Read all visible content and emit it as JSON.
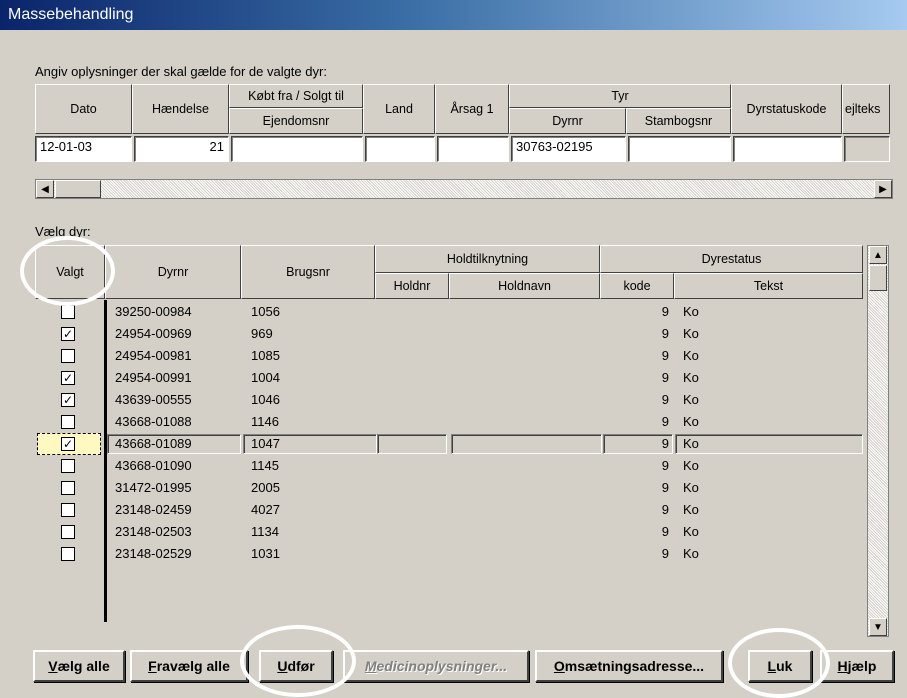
{
  "window": {
    "title": "Massebehandling"
  },
  "top_section": {
    "label": "Angiv oplysninger der skal gælde for de valgte dyr:",
    "headers": {
      "dato": "Dato",
      "haendelse": "Hændelse",
      "kobt_solgt": "Købt fra / Solgt til",
      "ejendomsnr": "Ejendomsnr",
      "land": "Land",
      "aarsag": "Årsag 1",
      "tyr": "Tyr",
      "dyrnr": "Dyrnr",
      "stambogsnr": "Stambogsnr",
      "dyrstatuskode": "Dyrstatuskode",
      "ejltekst": "ejlteks"
    },
    "values": {
      "dato": "12-01-03",
      "haendelse": "21",
      "ejendomsnr": "",
      "land": "",
      "aarsag": "",
      "dyrnr": "30763-02195",
      "stambogsnr": "",
      "dyrstatuskode": "",
      "ejltekst": ""
    }
  },
  "list_section": {
    "label": "Vælg dyr:",
    "headers": {
      "valgt": "Valgt",
      "dyrnr": "Dyrnr",
      "brugsnr": "Brugsnr",
      "holdtilknytning": "Holdtilknytning",
      "holdnr": "Holdnr",
      "holdnavn": "Holdnavn",
      "dyrestatus": "Dyrestatus",
      "kode": "kode",
      "tekst": "Tekst"
    },
    "rows": [
      {
        "checked": false,
        "dyrnr": "39250-00984",
        "brugsnr": "1056",
        "kode": "9",
        "tekst": "Ko"
      },
      {
        "checked": true,
        "dyrnr": "24954-00969",
        "brugsnr": "969",
        "kode": "9",
        "tekst": "Ko"
      },
      {
        "checked": false,
        "dyrnr": "24954-00981",
        "brugsnr": "1085",
        "kode": "9",
        "tekst": "Ko"
      },
      {
        "checked": true,
        "dyrnr": "24954-00991",
        "brugsnr": "1004",
        "kode": "9",
        "tekst": "Ko"
      },
      {
        "checked": true,
        "dyrnr": "43639-00555",
        "brugsnr": "1046",
        "kode": "9",
        "tekst": "Ko"
      },
      {
        "checked": false,
        "dyrnr": "43668-01088",
        "brugsnr": "1146",
        "kode": "9",
        "tekst": "Ko"
      },
      {
        "checked": true,
        "dyrnr": "43668-01089",
        "brugsnr": "1047",
        "kode": "9",
        "tekst": "Ko",
        "selected": true
      },
      {
        "checked": false,
        "dyrnr": "43668-01090",
        "brugsnr": "1145",
        "kode": "9",
        "tekst": "Ko"
      },
      {
        "checked": false,
        "dyrnr": "31472-01995",
        "brugsnr": "2005",
        "kode": "9",
        "tekst": "Ko"
      },
      {
        "checked": false,
        "dyrnr": "23148-02459",
        "brugsnr": "4027",
        "kode": "9",
        "tekst": "Ko"
      },
      {
        "checked": false,
        "dyrnr": "23148-02503",
        "brugsnr": "1134",
        "kode": "9",
        "tekst": "Ko"
      },
      {
        "checked": false,
        "dyrnr": "23148-02529",
        "brugsnr": "1031",
        "kode": "9",
        "tekst": "Ko"
      }
    ]
  },
  "buttons": {
    "vaelg_alle": {
      "accel": "V",
      "rest": "ælg alle"
    },
    "fravaelg_alle": {
      "accel": "F",
      "rest": "ravælg alle"
    },
    "udfoer": {
      "accel": "U",
      "rest": "dfør"
    },
    "medicin": {
      "accel": "M",
      "rest": "edicinoplysninger..."
    },
    "omsaetning": {
      "accel": "O",
      "rest": "msætningsadresse..."
    },
    "luk": {
      "accel": "L",
      "rest": "uk"
    },
    "hjaelp": {
      "accel": "H",
      "rest": "jælp"
    }
  },
  "glyphs": {
    "check": "✓",
    "left_arrow": "◀",
    "right_arrow": "▶",
    "up_arrow": "▲",
    "down_arrow": "▼"
  }
}
